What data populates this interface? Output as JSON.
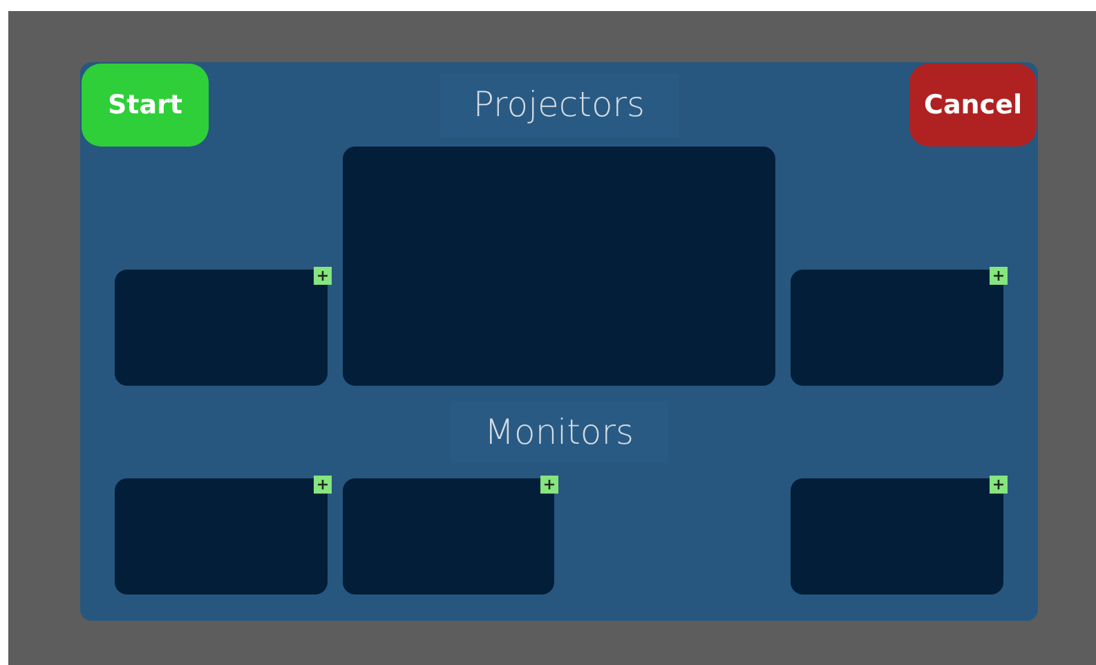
{
  "buttons": [
    {
      "label": "Start",
      "kind": "start"
    },
    {
      "label": "Cancel",
      "kind": "cancel"
    }
  ],
  "projectors": {
    "title": "Projectors",
    "screens": [
      {
        "add_button": true
      },
      {
        "add_button": false
      },
      {
        "add_button": true
      }
    ]
  },
  "monitors": {
    "title": "Monitors",
    "screens": [
      {
        "add_button": true
      },
      {
        "add_button": true
      },
      {
        "add_button": true
      }
    ]
  }
}
